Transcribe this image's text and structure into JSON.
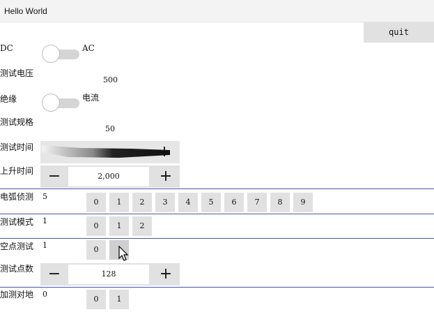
{
  "window": {
    "title": "Hello World"
  },
  "quit_label": "quit",
  "toggles": [
    {
      "left_label": "DC",
      "right_label": "AC",
      "on": false
    },
    {
      "left_label": "绝缘",
      "right_label": "电流",
      "on": false
    }
  ],
  "fields": {
    "test_voltage": {
      "label": "测试电压",
      "value": "500"
    },
    "test_spec": {
      "label": "测试规格",
      "value": "50"
    },
    "test_time": {
      "label": "测试时间"
    },
    "rise_time": {
      "label": "上升时间",
      "value": "2,000"
    },
    "test_points": {
      "label": "测试点数",
      "value": "128"
    }
  },
  "selectors": {
    "arc_detect": {
      "label": "电弧侦测",
      "value": "5",
      "options": [
        "0",
        "1",
        "2",
        "3",
        "4",
        "5",
        "6",
        "7",
        "8",
        "9"
      ]
    },
    "test_mode": {
      "label": "测试模式",
      "value": "1",
      "options": [
        "0",
        "1",
        "2"
      ]
    },
    "empty_test": {
      "label": "空点测试",
      "value": "1",
      "options": [
        "0"
      ]
    },
    "ground_test": {
      "label": "加测对地",
      "value": "0",
      "options": [
        "0",
        "1"
      ]
    }
  },
  "icons": {
    "minus": "−",
    "plus": "+"
  }
}
